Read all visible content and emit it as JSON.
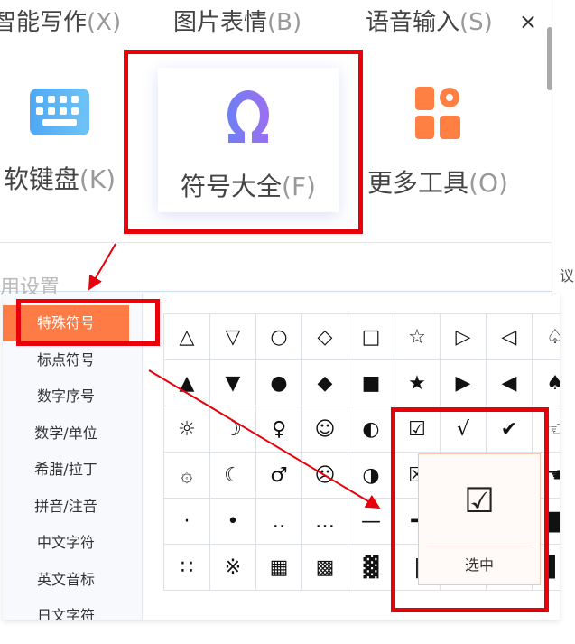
{
  "tabs": [
    {
      "label": "智能写作",
      "key": "(X)"
    },
    {
      "label": "图片表情",
      "key": "(B)"
    },
    {
      "label": "语音输入",
      "key": "(S)"
    }
  ],
  "close_label": "×",
  "tools": [
    {
      "label": "软键盘",
      "key": "(K)",
      "icon": "keyboard-icon"
    },
    {
      "label": "符号大全",
      "key": "(F)",
      "icon": "omega-icon"
    },
    {
      "label": "更多工具",
      "key": "(O)",
      "icon": "more-tools-icon"
    }
  ],
  "common_settings": "用设置",
  "side_text": "议",
  "categories": [
    "特殊符号",
    "标点符号",
    "数字序号",
    "数学/单位",
    "希腊/拉丁",
    "拼音/注音",
    "中文字符",
    "英文音标",
    "日文字符"
  ],
  "active_category": "特殊符号",
  "symbols": [
    [
      "△",
      "▽",
      "○",
      "◇",
      "□",
      "☆",
      "▷",
      "◁",
      "♤"
    ],
    [
      "▲",
      "▼",
      "●",
      "◆",
      "■",
      "★",
      "▶",
      "◀",
      "♠"
    ],
    [
      "☼",
      "☽",
      "♀",
      "☺",
      "◐",
      "☑",
      "√",
      "✔",
      "☜"
    ],
    [
      "۞",
      "☾",
      "♂",
      "☹",
      "◑",
      "☒",
      "",
      "",
      "☚"
    ],
    [
      "·",
      "•",
      "‥",
      "…",
      "—",
      "━",
      "",
      "",
      "▇"
    ],
    [
      "∷",
      "※",
      "▦",
      "▩",
      "▓",
      "|",
      "",
      "",
      "▌"
    ]
  ],
  "popup": {
    "symbol": "☑",
    "label": "选中"
  },
  "colors": {
    "accent": "#ff7b45",
    "highlight": "#e8000b"
  }
}
